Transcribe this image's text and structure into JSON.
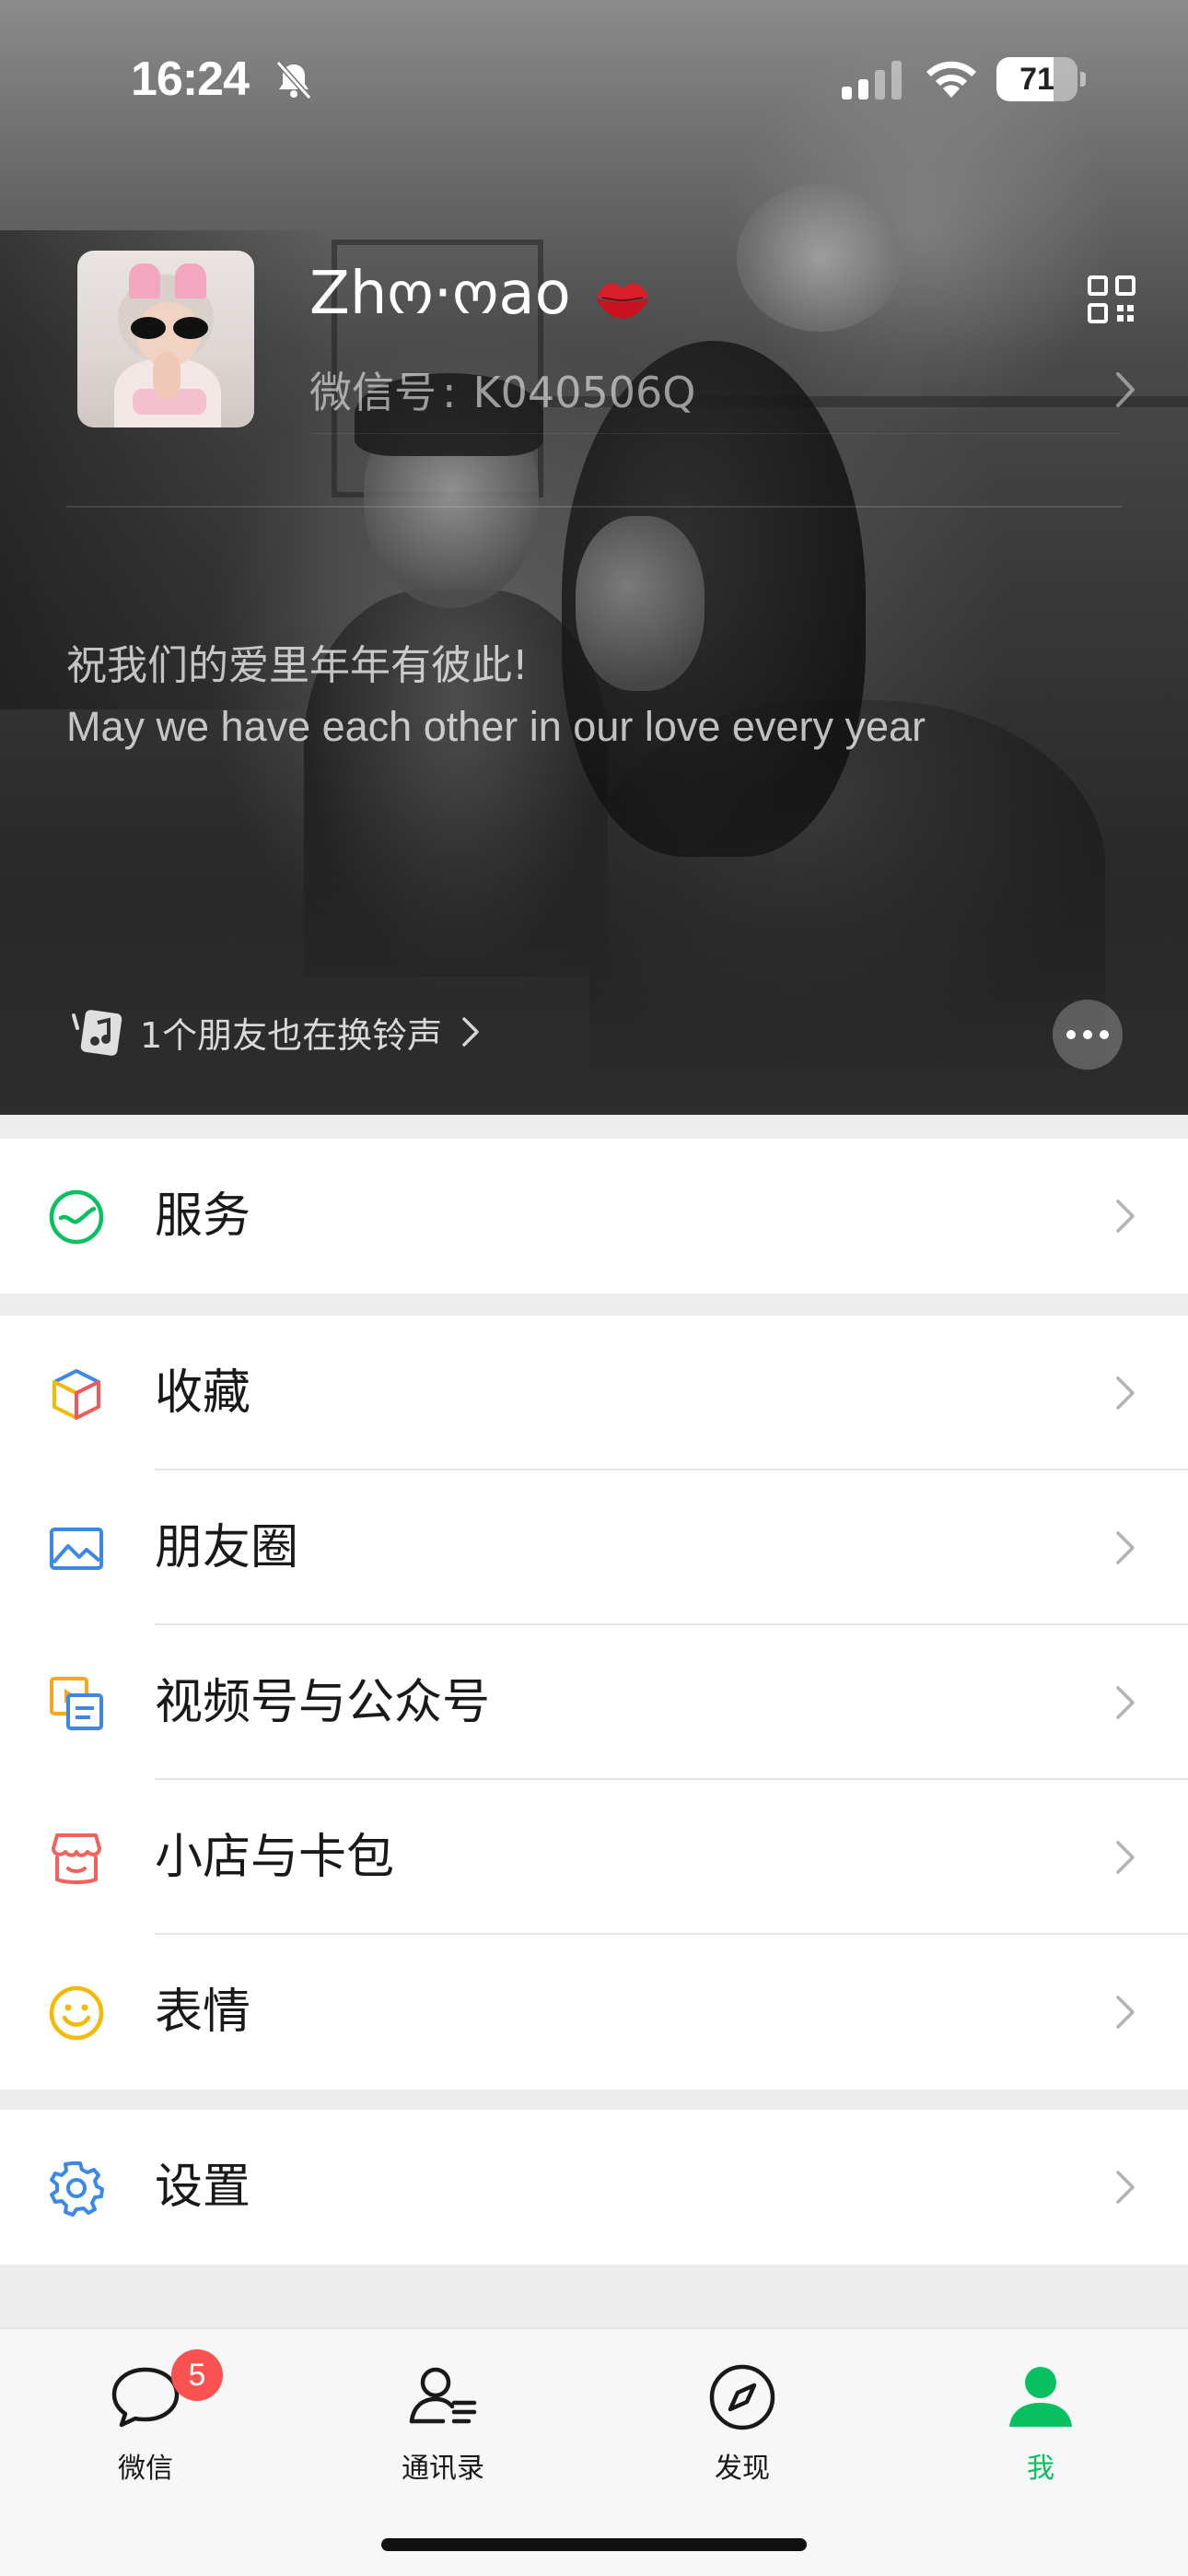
{
  "status_bar": {
    "time": "16:24",
    "battery_percent": "71",
    "battery_level": 0.71
  },
  "profile": {
    "nickname": "Zhო·ოao",
    "wechat_id_label": "微信号",
    "wechat_id_sep": ":",
    "wechat_id": "K040506Q",
    "status_line_cn": "祝我们的爱里年年有彼此!",
    "status_line_en": "May we have each other in our love every year",
    "ringtone_text": "1个朋友也在换铃声"
  },
  "menu": {
    "service": {
      "label": "服务",
      "icon": "service-icon"
    },
    "favorites": {
      "label": "收藏",
      "icon": "favorites-cube-icon"
    },
    "moments": {
      "label": "朋友圈",
      "icon": "moments-image-icon"
    },
    "channels": {
      "label": "视频号与公众号",
      "icon": "channels-icon"
    },
    "shop": {
      "label": "小店与卡包",
      "icon": "shop-icon"
    },
    "stickers": {
      "label": "表情",
      "icon": "smiley-icon"
    },
    "settings": {
      "label": "设置",
      "icon": "gear-icon"
    }
  },
  "tabbar": {
    "chats": {
      "label": "微信",
      "badge": "5"
    },
    "contacts": {
      "label": "通讯录"
    },
    "discover": {
      "label": "发现"
    },
    "me": {
      "label": "我"
    }
  },
  "colors": {
    "accent_green": "#07c160",
    "badge_red": "#fa5151",
    "background": "#ededed"
  }
}
